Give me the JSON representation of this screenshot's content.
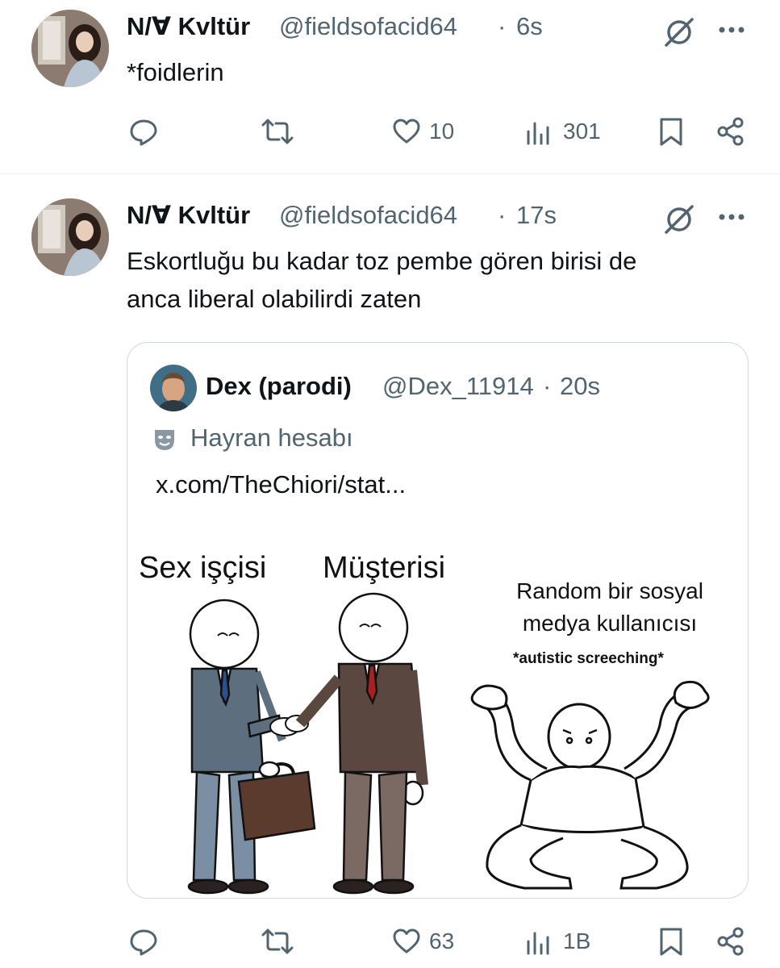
{
  "colors": {
    "text": "#0f1419",
    "muted": "#536471",
    "border": "#cfd9de",
    "divider": "#eff3f4"
  },
  "tweets": [
    {
      "display_name": "N/∀ Kvltür",
      "handle": "@fieldsofacid64",
      "dot": "·",
      "time": "6s",
      "text": "*foidlerin",
      "actions": {
        "likes": "10",
        "views": "301"
      }
    },
    {
      "display_name": "N/∀ Kvltür",
      "handle": "@fieldsofacid64",
      "dot": "·",
      "time": "17s",
      "text_lines": [
        "Eskortluğu bu kadar toz pembe gören birisi de",
        "anca liberal olabilirdi zaten"
      ],
      "actions": {
        "likes": "63",
        "views": "1B"
      }
    }
  ],
  "quote": {
    "display_name": "Dex (parodi)",
    "handle": "@Dex_11914",
    "dot": "·",
    "time": "20s",
    "badge": "Hayran hesabı",
    "link": "x.com/TheChiori/stat...",
    "meme": {
      "label_left": "Sex işçisi",
      "label_middle": "Müşterisi",
      "label_right_line1": "Random bir sosyal",
      "label_right_line2": "medya kullanıcısı",
      "label_right_small": "*autistic screeching*"
    }
  },
  "icons": [
    "grok-icon",
    "more-icon",
    "reply-icon",
    "retweet-icon",
    "like-icon",
    "views-icon",
    "bookmark-icon",
    "share-icon",
    "theater-masks-icon"
  ]
}
